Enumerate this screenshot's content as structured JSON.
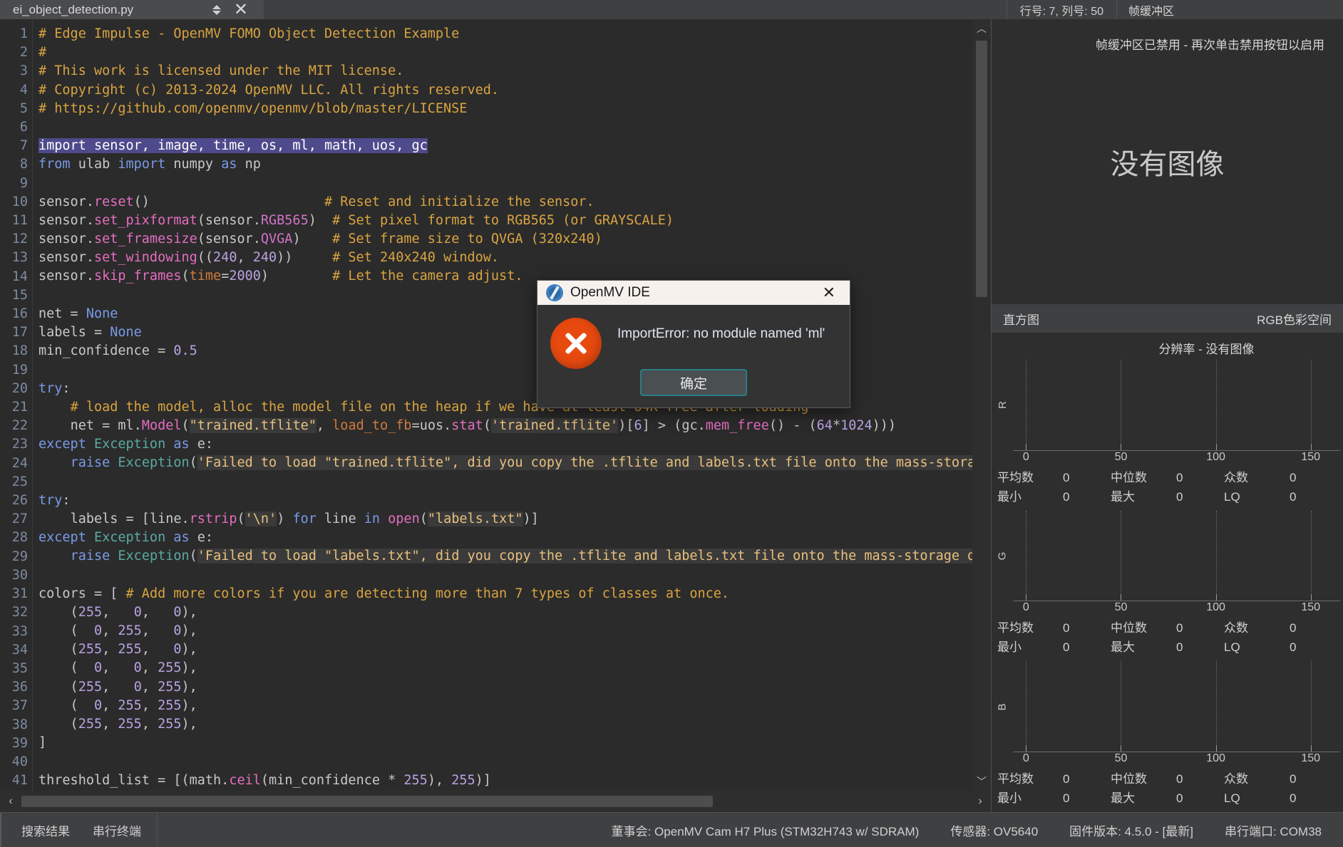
{
  "window": {
    "filename": "ei_object_detection.py",
    "line_col": "行号: 7, 列号: 50",
    "framebuffer_title": "帧缓冲区"
  },
  "editor": {
    "cursor_line": 7,
    "first_line": 1,
    "lines": [
      {
        "n": 1,
        "t": "# Edge Impulse - OpenMV FOMO Object Detection Example"
      },
      {
        "n": 2,
        "t": "#"
      },
      {
        "n": 3,
        "t": "# This work is licensed under the MIT license."
      },
      {
        "n": 4,
        "t": "# Copyright (c) 2013-2024 OpenMV LLC. All rights reserved."
      },
      {
        "n": 5,
        "t": "# https://github.com/openmv/openmv/blob/master/LICENSE"
      },
      {
        "n": 6,
        "t": ""
      },
      {
        "n": 7,
        "t": "import sensor, image, time, os, ml, math, uos, gc"
      },
      {
        "n": 8,
        "t": "from ulab import numpy as np"
      },
      {
        "n": 9,
        "t": ""
      },
      {
        "n": 10,
        "t": "sensor.reset()                      # Reset and initialize the sensor."
      },
      {
        "n": 11,
        "t": "sensor.set_pixformat(sensor.RGB565)  # Set pixel format to RGB565 (or GRAYSCALE)"
      },
      {
        "n": 12,
        "t": "sensor.set_framesize(sensor.QVGA)    # Set frame size to QVGA (320x240)"
      },
      {
        "n": 13,
        "t": "sensor.set_windowing((240, 240))     # Set 240x240 window."
      },
      {
        "n": 14,
        "t": "sensor.skip_frames(time=2000)        # Let the camera adjust."
      },
      {
        "n": 15,
        "t": ""
      },
      {
        "n": 16,
        "t": "net = None"
      },
      {
        "n": 17,
        "t": "labels = None"
      },
      {
        "n": 18,
        "t": "min_confidence = 0.5"
      },
      {
        "n": 19,
        "t": ""
      },
      {
        "n": 20,
        "t": "try:"
      },
      {
        "n": 21,
        "t": "    # load the model, alloc the model file on the heap if we have at least 64K free after loading"
      },
      {
        "n": 22,
        "t": "    net = ml.Model(\"trained.tflite\", load_to_fb=uos.stat('trained.tflite')[6] > (gc.mem_free() - (64*1024)))"
      },
      {
        "n": 23,
        "t": "except Exception as e:"
      },
      {
        "n": 24,
        "t": "    raise Exception('Failed to load \"trained.tflite\", did you copy the .tflite and labels.txt file onto the mass-storage device? ' + str(e))"
      },
      {
        "n": 25,
        "t": ""
      },
      {
        "n": 26,
        "t": "try:"
      },
      {
        "n": 27,
        "t": "    labels = [line.rstrip('\\n') for line in open(\"labels.txt\")]"
      },
      {
        "n": 28,
        "t": "except Exception as e:"
      },
      {
        "n": 29,
        "t": "    raise Exception('Failed to load \"labels.txt\", did you copy the .tflite and labels.txt file onto the mass-storage device? ' + str(e))"
      },
      {
        "n": 30,
        "t": ""
      },
      {
        "n": 31,
        "t": "colors = [ # Add more colors if you are detecting more than 7 types of classes at once."
      },
      {
        "n": 32,
        "t": "    (255,   0,   0),"
      },
      {
        "n": 33,
        "t": "    (  0, 255,   0),"
      },
      {
        "n": 34,
        "t": "    (255, 255,   0),"
      },
      {
        "n": 35,
        "t": "    (  0,   0, 255),"
      },
      {
        "n": 36,
        "t": "    (255,   0, 255),"
      },
      {
        "n": 37,
        "t": "    (  0, 255, 255),"
      },
      {
        "n": 38,
        "t": "    (255, 255, 255),"
      },
      {
        "n": 39,
        "t": "]"
      },
      {
        "n": 40,
        "t": ""
      },
      {
        "n": 41,
        "t": "threshold_list = [(math.ceil(min_confidence * 255), 255)]"
      }
    ]
  },
  "framebuffer": {
    "disabled_message": "帧缓冲区已禁用 - 再次单击禁用按钮以启用",
    "no_image": "没有图像"
  },
  "histogram": {
    "title": "直方图",
    "colorspace": "RGB色彩空间",
    "resolution": "分辨率 - 没有图像",
    "axis_ticks": [
      "0",
      "50",
      "100",
      "150"
    ],
    "channels": [
      {
        "label": "R",
        "stats": [
          [
            {
              "k": "平均数",
              "v": "0"
            },
            {
              "k": "中位数",
              "v": "0"
            },
            {
              "k": "众数",
              "v": "0"
            }
          ],
          [
            {
              "k": "最小",
              "v": "0"
            },
            {
              "k": "最大",
              "v": "0"
            },
            {
              "k": "LQ",
              "v": "0"
            }
          ]
        ]
      },
      {
        "label": "G",
        "stats": [
          [
            {
              "k": "平均数",
              "v": "0"
            },
            {
              "k": "中位数",
              "v": "0"
            },
            {
              "k": "众数",
              "v": "0"
            }
          ],
          [
            {
              "k": "最小",
              "v": "0"
            },
            {
              "k": "最大",
              "v": "0"
            },
            {
              "k": "LQ",
              "v": "0"
            }
          ]
        ]
      },
      {
        "label": "B",
        "stats": [
          [
            {
              "k": "平均数",
              "v": "0"
            },
            {
              "k": "中位数",
              "v": "0"
            },
            {
              "k": "众数",
              "v": "0"
            }
          ],
          [
            {
              "k": "最小",
              "v": "0"
            },
            {
              "k": "最大",
              "v": "0"
            },
            {
              "k": "LQ",
              "v": "0"
            }
          ]
        ]
      }
    ]
  },
  "dialog": {
    "title": "OpenMV IDE",
    "message": "ImportError: no module named 'ml'",
    "ok_label": "确定",
    "close_label": "✕"
  },
  "bottom": {
    "tabs": [
      "搜索结果",
      "串行终端"
    ],
    "board": "董事会: OpenMV Cam H7 Plus (STM32H743 w/ SDRAM)",
    "sensor": "传感器: OV5640",
    "firmware": "固件版本: 4.5.0 - [最新]",
    "serial": "串行端口: COM38"
  },
  "colors": {
    "accent": "#e8490f",
    "selection": "#4e4a8c",
    "comment": "#d9a441",
    "keyword": "#7a9ae8",
    "string": "#e8c07d",
    "panel": "#3f4042",
    "background": "#2b2b2b"
  }
}
